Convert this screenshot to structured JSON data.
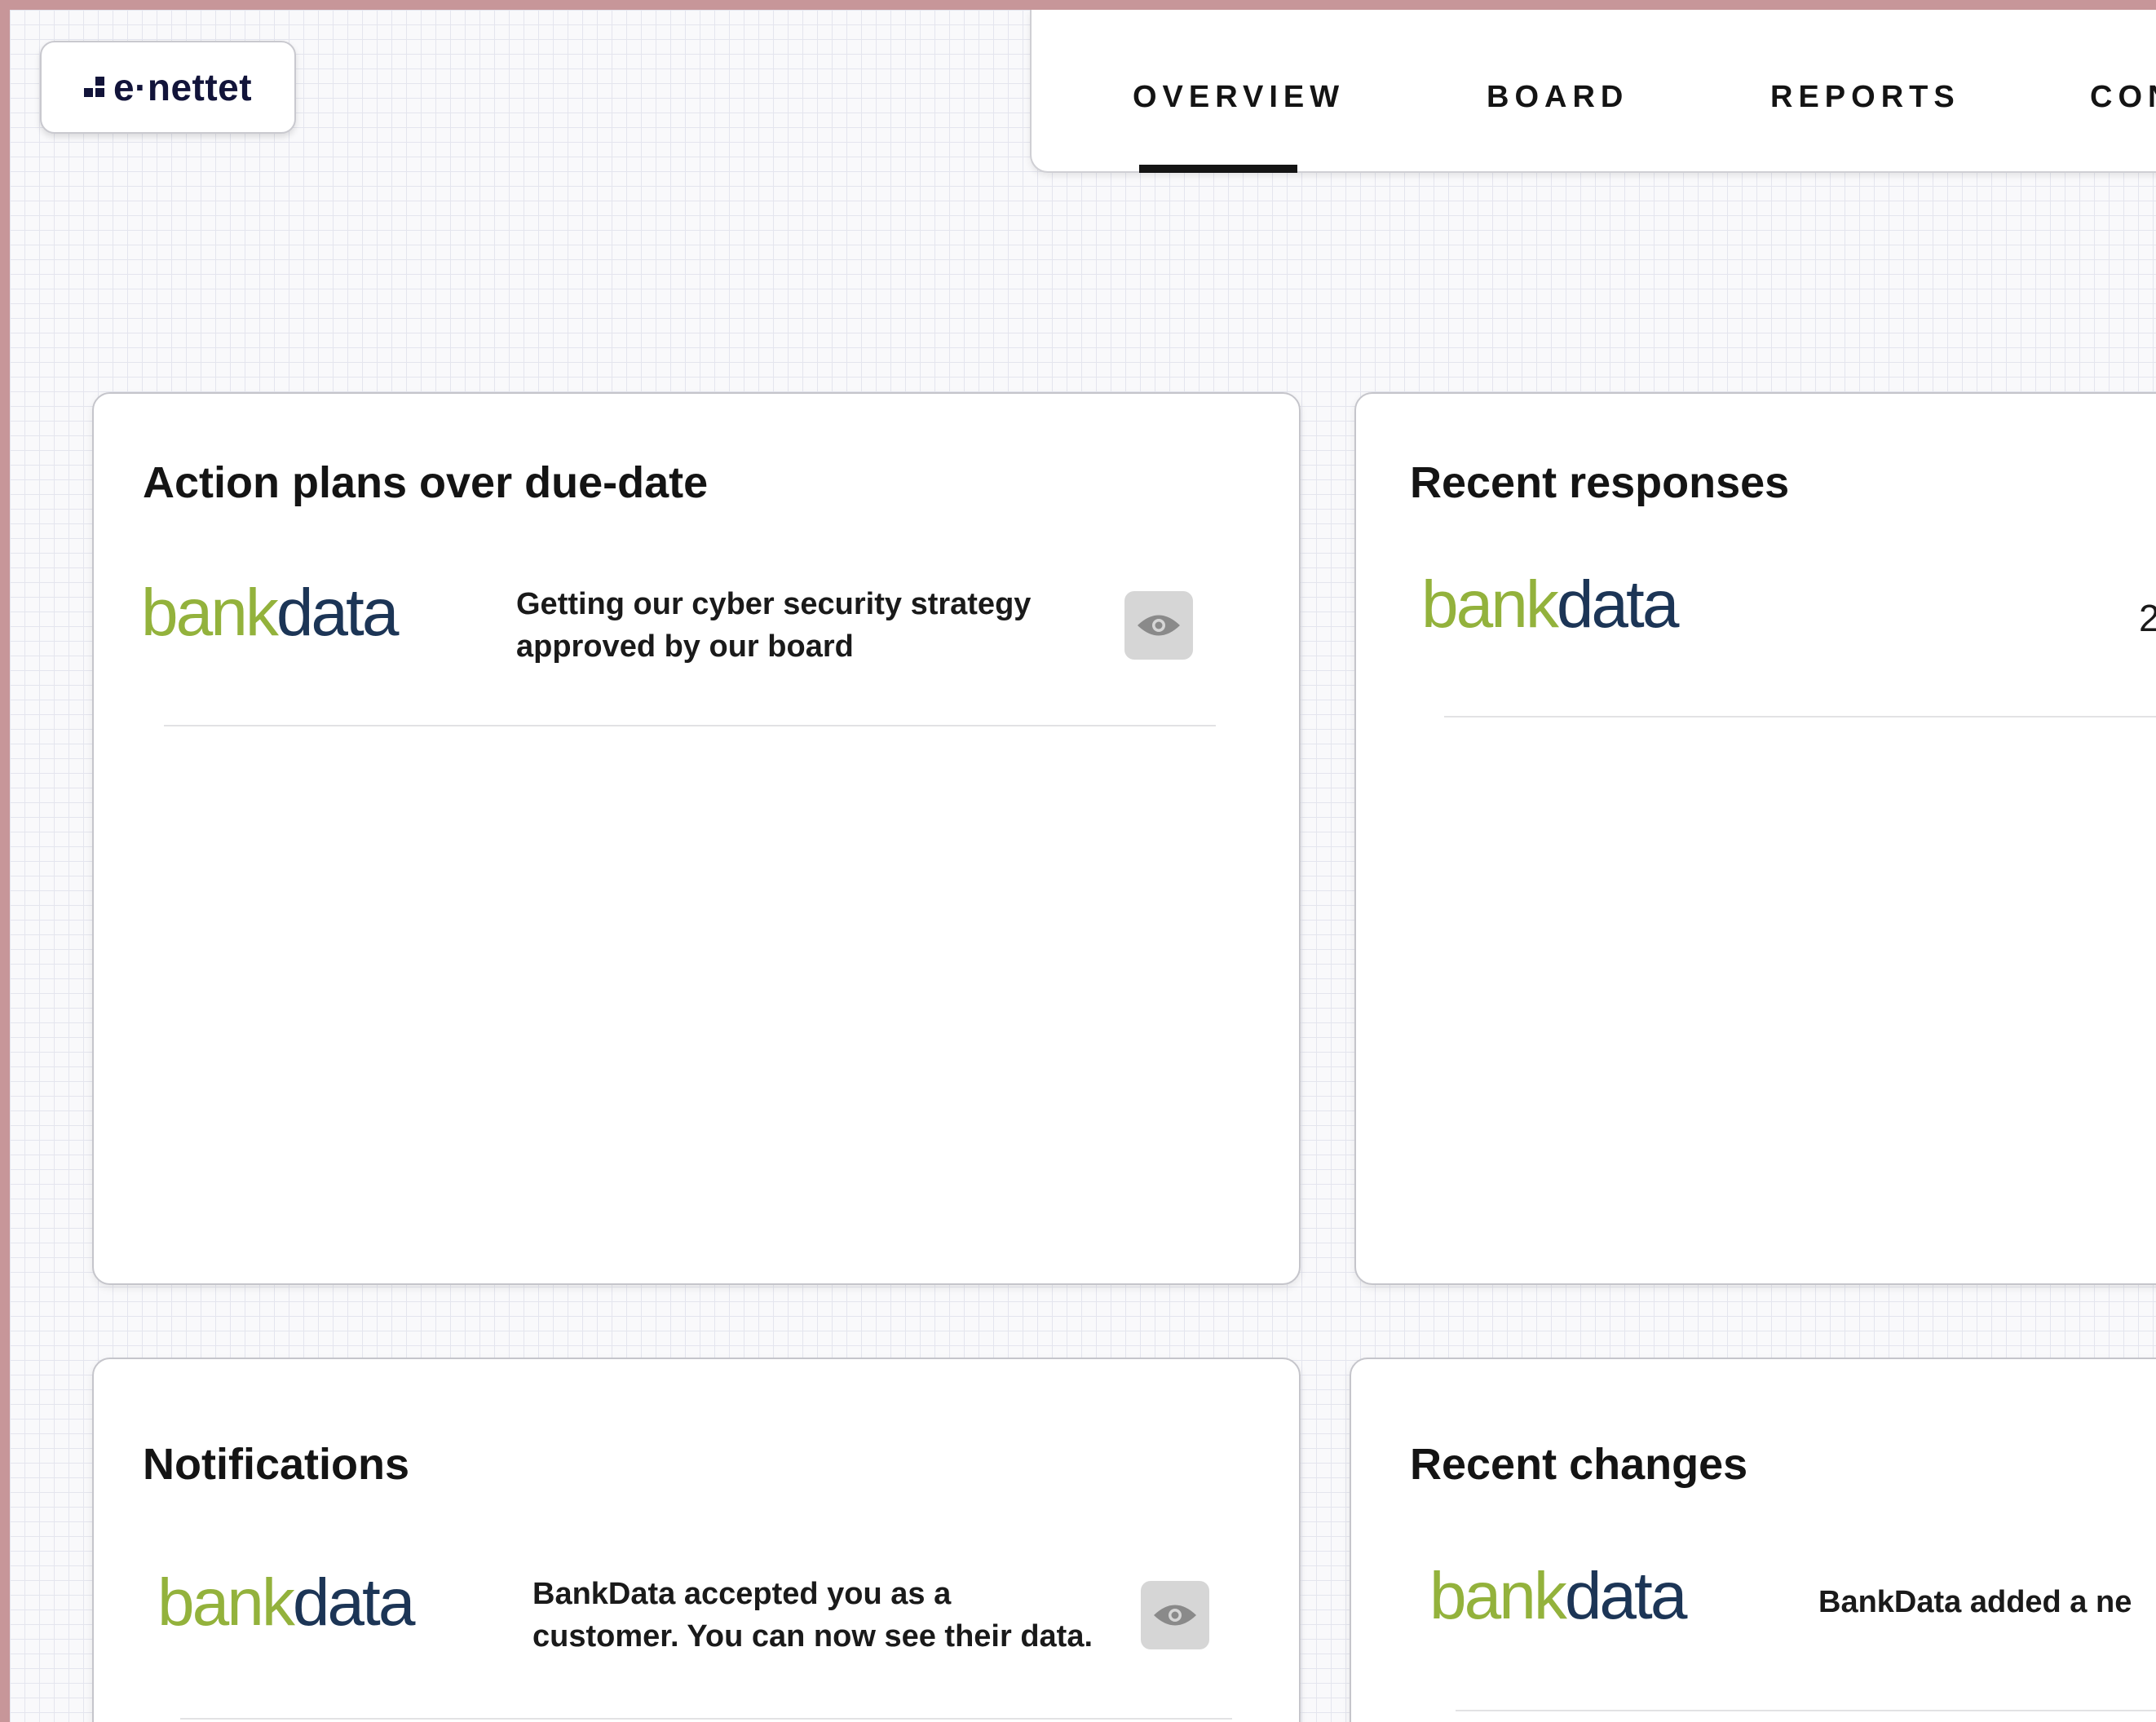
{
  "app": {
    "logo_text": "e·nettet"
  },
  "nav": {
    "tabs": [
      "OVERVIEW",
      "BOARD",
      "REPORTS",
      "CON"
    ],
    "active": "OVERVIEW"
  },
  "cards": {
    "action_plans": {
      "title": "Action plans over due-date",
      "item": {
        "company_logo": {
          "part1": "bank",
          "part2": "data"
        },
        "text": "Getting our cyber security strategy approved by our board",
        "action_icon": "eye-icon"
      }
    },
    "recent_responses": {
      "title": "Recent responses",
      "item": {
        "company_logo": {
          "part1": "bank",
          "part2": "data"
        },
        "trailing_text": "2"
      }
    },
    "notifications": {
      "title": "Notifications",
      "item": {
        "company_logo": {
          "part1": "bank",
          "part2": "data"
        },
        "text": "BankData accepted you as a customer. You can now see their data.",
        "action_icon": "eye-icon"
      }
    },
    "recent_changes": {
      "title": "Recent changes",
      "item": {
        "company_logo": {
          "part1": "bank",
          "part2": "data"
        },
        "text": "BankData added a ne"
      }
    }
  },
  "colors": {
    "outer_border": "#c79699",
    "brand_dark": "#12143a",
    "bankdata_green": "#93b23c",
    "bankdata_navy": "#1c3556",
    "icon_button_bg": "#d6d6d6"
  }
}
